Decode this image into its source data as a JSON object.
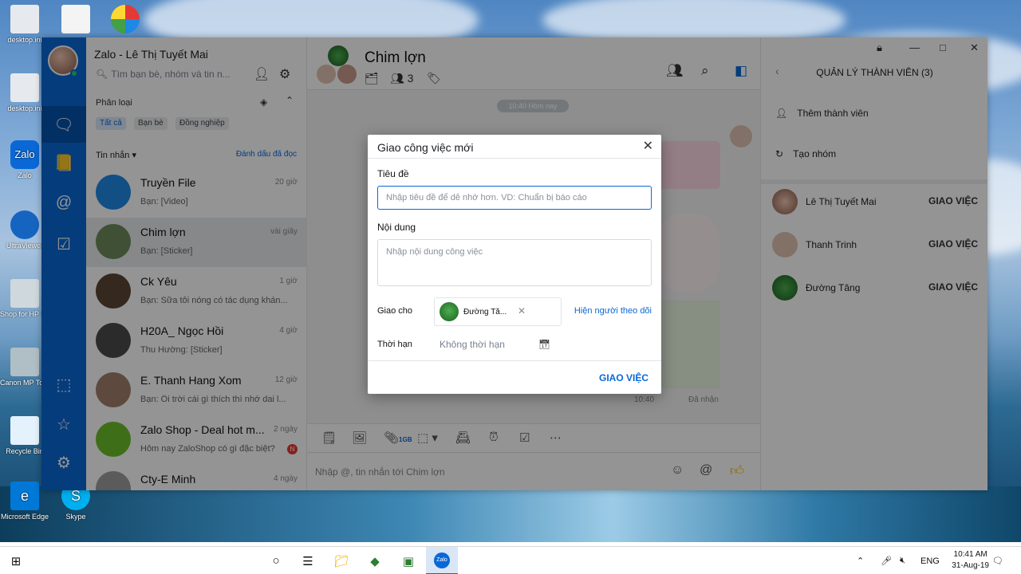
{
  "desktop": {
    "icons": [
      {
        "label": "desktop.ini"
      },
      {
        "label": "desktop.ini"
      },
      {
        "label": "Zalo"
      },
      {
        "label": "UltraViewer"
      },
      {
        "label": "Shop for HP Supplies"
      },
      {
        "label": "Canon MP Toolbox"
      },
      {
        "label": "Recycle Bin"
      },
      {
        "label": "Microsoft Edge"
      },
      {
        "label": "Skype"
      }
    ]
  },
  "sidebar": {
    "app_title": "Zalo - Lê Thị Tuyết Mai",
    "search_placeholder": "Tìm bạn bè, nhóm và tin n...",
    "category_title": "Phân loại",
    "chips": [
      "Tất cả",
      "Bạn bè",
      "Đồng nghiệp"
    ],
    "inbox_title": "Tin nhắn",
    "mark_read": "Đánh dấu đã đọc",
    "conversations": [
      {
        "name": "Truyền File",
        "time": "20 giờ",
        "preview": "Bạn: [Video]",
        "color": "#1e88e5"
      },
      {
        "name": "Chim lợn",
        "time": "vài giây",
        "preview": "Bạn: [Sticker]",
        "color": "#6d8b5a"
      },
      {
        "name": "Ck Yêu",
        "time": "1 giờ",
        "preview": "Bạn: Sữa tôi nóng có tác dụng khán...",
        "color": "#5b4636"
      },
      {
        "name": "H20A_ Ngọc Hồi",
        "time": "4 giờ",
        "preview": "Thu Hường: [Sticker]",
        "color": "#4a4a4a"
      },
      {
        "name": "E. Thanh Hang Xom",
        "time": "12 giờ",
        "preview": "Bạn: Ôi trời cái gì thích thì nhớ dai l...",
        "color": "#a07f6a"
      },
      {
        "name": "Zalo Shop - Deal hot m...",
        "time": "2 ngày",
        "preview": "Hôm nay ZaloShop có gì đặc biệt?",
        "color": "#6bbf2a",
        "badge": "N"
      },
      {
        "name": "Cty-E Minh",
        "time": "4 ngày",
        "preview": "",
        "color": "#9e9e9e"
      }
    ]
  },
  "chat": {
    "name": "Chim lợn",
    "member_count": "3",
    "date_pill": "10:40 Hôm nay",
    "sticker_time": "10:40",
    "received": "Đã nhận",
    "composer_placeholder": "Nhập @, tin nhắn tới Chim lợn",
    "file_badge": "1GB"
  },
  "members": {
    "title": "QUẢN LÝ THÀNH VIÊN (3)",
    "add_member": "Thêm thành viên",
    "create_group": "Tạo nhóm",
    "list": [
      {
        "name": "Lê Thị Tuyết Mai",
        "action": "GIAO VIỆC"
      },
      {
        "name": "Thanh Trinh",
        "action": "GIAO VIỆC"
      },
      {
        "name": "Đường Tăng",
        "action": "GIAO VIỆC"
      }
    ]
  },
  "dialog": {
    "title": "Giao công việc mới",
    "title_label": "Tiêu đề",
    "title_placeholder": "Nhập tiêu đề để dễ nhớ hơn. VD: Chuẩn bị báo cáo",
    "content_label": "Nội dung",
    "content_placeholder": "Nhập nội dung công việc",
    "assign_label": "Giao cho",
    "assignee": "Đường Tă...",
    "followers_link": "Hiện người theo dõi",
    "deadline_label": "Thời hạn",
    "deadline_value": "Không thời hạn",
    "submit": "GIAO VIỆC"
  },
  "taskbar": {
    "language": "ENG",
    "time": "10:41 AM",
    "date": "31-Aug-19"
  }
}
